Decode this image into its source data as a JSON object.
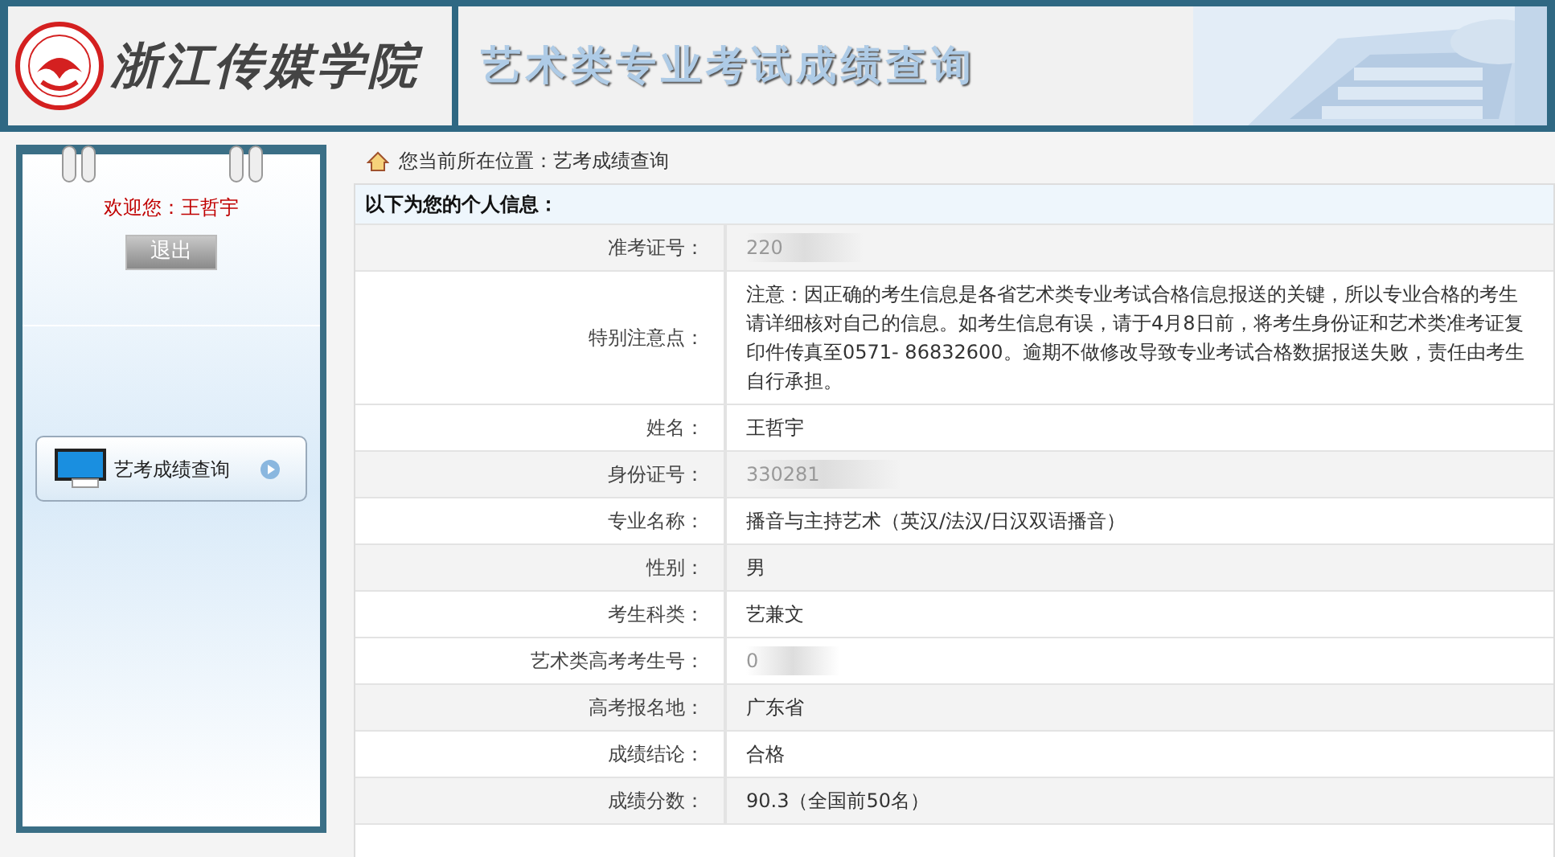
{
  "header": {
    "school_name": "浙江传媒学院",
    "title": "艺术类专业考试成绩查询"
  },
  "sidebar": {
    "welcome": "欢迎您：王哲宇",
    "logout_button": "退出",
    "menu": [
      {
        "label": "艺考成绩查询",
        "selected": false
      }
    ]
  },
  "breadcrumb": "您当前所在位置：艺考成绩查询",
  "info": {
    "heading": "以下为您的个人信息：",
    "rows": [
      {
        "label": "准考证号：",
        "value": "220",
        "masked": true,
        "shaded": true
      },
      {
        "label": "特别注意点：",
        "value": "注意：因正确的考生信息是各省艺术类专业考试合格信息报送的关键，所以专业合格的考生请详细核对自己的信息。如考生信息有误，请于4月8日前，将考生身份证和艺术类准考证复印件传真至0571- 86832600。逾期不做修改导致专业考试合格数据报送失败，责任由考生自行承担。",
        "masked": false,
        "shaded": false
      },
      {
        "label": "姓名：",
        "value": "王哲宇",
        "masked": false,
        "shaded": false
      },
      {
        "label": "身份证号：",
        "value": "330281",
        "masked": true,
        "shaded": true
      },
      {
        "label": "专业名称：",
        "value": "播音与主持艺术（英汉/法汉/日汉双语播音）",
        "masked": false,
        "shaded": false
      },
      {
        "label": "性别：",
        "value": "男",
        "masked": false,
        "shaded": true
      },
      {
        "label": "考生科类：",
        "value": "艺兼文",
        "masked": false,
        "shaded": false
      },
      {
        "label": "艺术类高考考生号：",
        "value": "0",
        "masked": true,
        "shaded": false
      },
      {
        "label": "高考报名地：",
        "value": "广东省",
        "masked": false,
        "shaded": true
      },
      {
        "label": "成绩结论：",
        "value": "合格",
        "masked": false,
        "shaded": false
      },
      {
        "label": "成绩分数：",
        "value": "90.3（全国前50名）",
        "masked": false,
        "shaded": true
      }
    ]
  }
}
